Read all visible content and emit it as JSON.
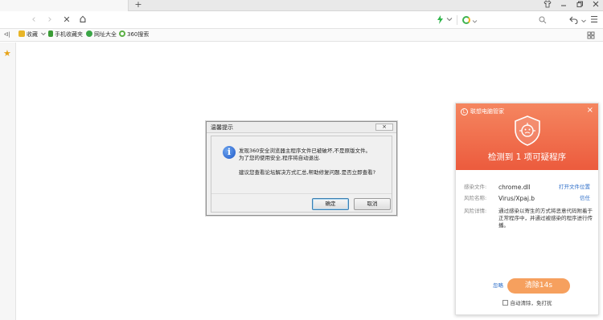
{
  "tabbar": {
    "new_tab": "+",
    "window_controls": [
      "shirt-icon",
      "minimize-icon",
      "restore-icon",
      "close-icon"
    ]
  },
  "navbar": {
    "back": "‹",
    "forward": "›",
    "stop": "✕",
    "home": "⌂",
    "menu": "☰"
  },
  "bookmarks": {
    "toggle": "ᐊ|",
    "items": [
      {
        "label": "收藏",
        "icon": "star-folder-icon",
        "color": "#e8b528"
      },
      {
        "label": "手机收藏夹",
        "icon": "phone-icon",
        "color": "#3a9b35"
      },
      {
        "label": "网址大全",
        "icon": "globe-icon",
        "color": "#3aa546"
      },
      {
        "label": "360搜索",
        "icon": "search-360-icon",
        "color": "#5bb045"
      }
    ]
  },
  "dialog": {
    "title": "温馨提示",
    "close": "×",
    "line1": "发现360安全浏览器主程序文件已被破坏,不是原版文件。",
    "line2": "为了您的使用安全,程序将自动退出.",
    "line3": "建议您查看论坛解决方式汇总,帮助修复问题.是否立即查看?",
    "ok": "确定",
    "cancel": "取消"
  },
  "popup": {
    "brand": "联想电脑管家",
    "close": "×",
    "title": "检测到 1 项可疑程序",
    "accent": "#ec5b3d",
    "file_label": "感染文件:",
    "file_value": "chrome.dll",
    "file_action": "打开文件位置",
    "risk_label": "风险名称:",
    "risk_value": "Virus/Xpaj.b",
    "risk_action": "信任",
    "detail_label": "风险详情:",
    "detail_value": "通过感染以寄生的方式将恶意代码附着于正常程序中，并通过被感染的程序进行传播。",
    "ignore": "忽略",
    "clean_button": "清除14s",
    "auto_clean": "自动清除，免打扰"
  }
}
